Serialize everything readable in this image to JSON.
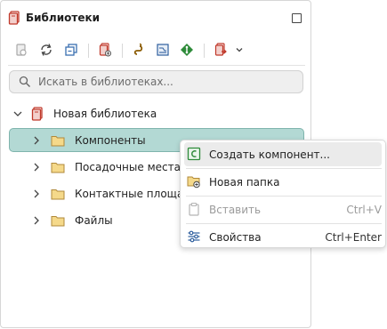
{
  "panel": {
    "title": "Библиотеки",
    "search": {
      "placeholder": "Искать в библиотеках...",
      "value": ""
    }
  },
  "toolbar": {
    "icons": [
      "library-properties-icon",
      "refresh-icon",
      "collapse-all-icon",
      "new-library-icon",
      "link-icon",
      "schematic-icon",
      "footprint-icon",
      "add-library-icon",
      "chevron-down-icon"
    ]
  },
  "tree": {
    "root": {
      "label": "Новая библиотека",
      "expanded": true
    },
    "folders": [
      {
        "label": "Компоненты",
        "selected": true
      },
      {
        "label": "Посадочные места",
        "selected": false
      },
      {
        "label": "Контактные площад",
        "selected": false
      },
      {
        "label": "Файлы",
        "selected": false
      }
    ]
  },
  "context_menu": {
    "items": [
      {
        "label": "Создать компонент...",
        "shortcut": "",
        "enabled": true,
        "hovered": true
      },
      {
        "label": "Новая папка",
        "shortcut": "",
        "enabled": true,
        "hovered": false
      },
      {
        "label": "Вставить",
        "shortcut": "Ctrl+V",
        "enabled": false,
        "hovered": false
      },
      {
        "label": "Свойства",
        "shortcut": "Ctrl+Enter",
        "enabled": true,
        "hovered": false
      }
    ]
  },
  "colors": {
    "selection_bg": "#b3d9d4",
    "selection_border": "#7fb4ad",
    "library_icon": "#c0392b",
    "component_icon": "#2e8b3a",
    "folder_fill": "#f5d98a"
  }
}
